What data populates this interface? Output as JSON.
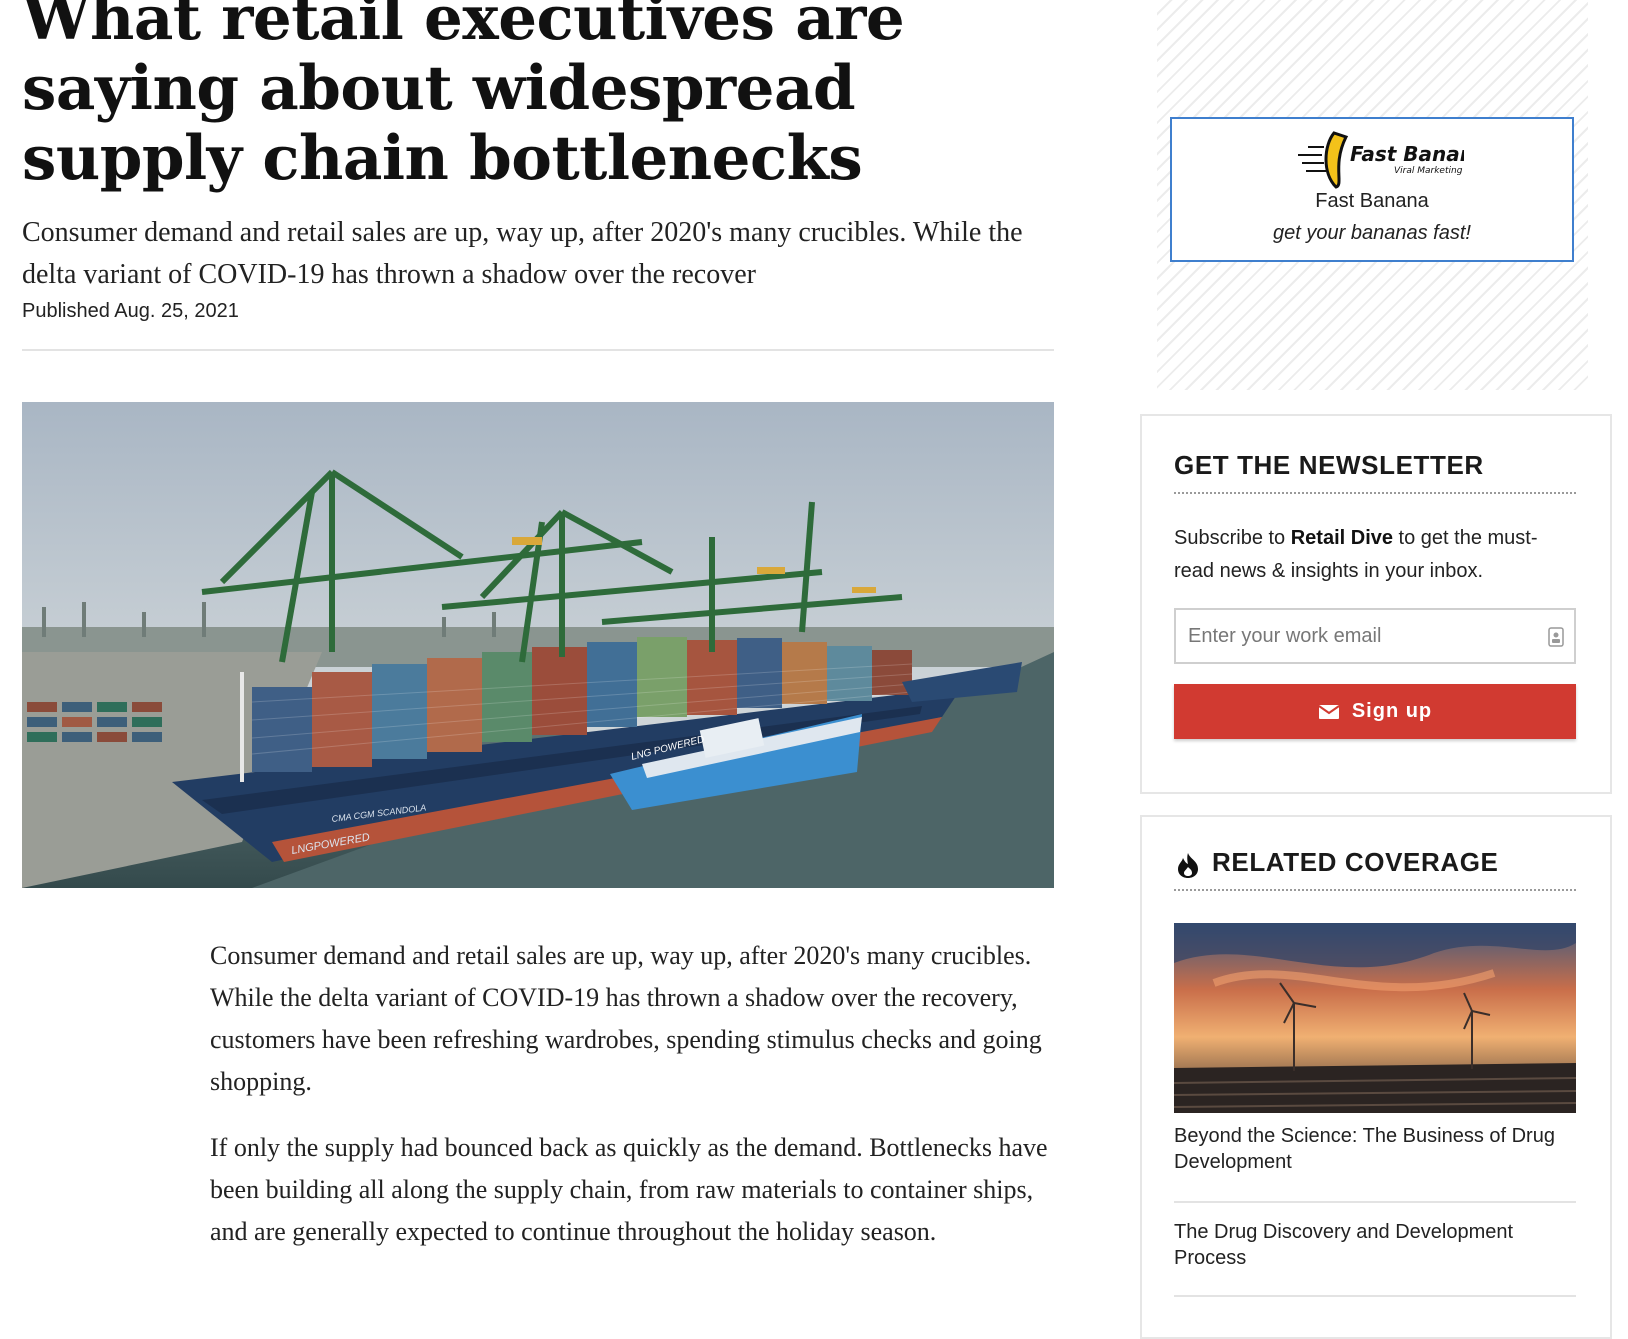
{
  "article": {
    "headline": "What retail executives are saying about widespread supply chain bottlenecks",
    "dek": "Consumer demand and retail sales are up, way up, after 2020's many crucibles. While the delta variant of COVID-19 has thrown a shadow over the recover",
    "published": "Published Aug. 25, 2021",
    "paragraphs": [
      "Consumer demand and retail sales are up, way up, after 2020's many crucibles. While the delta variant of COVID-19 has thrown a shadow over the recovery, customers have been refreshing wardrobes, spending stimulus checks and going shopping.",
      "If only the supply had bounced back as quickly as the demand. Bottlenecks have been building all along the supply chain, from raw materials to container ships, and are generally expected to continue throughout the holiday season."
    ],
    "hero_ship_labels": {
      "hull_name": "CMA CGM SCANDOLA",
      "hull_text": "LNGPOWERED",
      "bunker_text": "LNG POWERED"
    }
  },
  "ad": {
    "logo_text": "Fast Banana",
    "logo_subtext": "Viral Marketing",
    "name": "Fast Banana",
    "tagline": "get your bananas fast!"
  },
  "newsletter": {
    "title": "GET THE NEWSLETTER",
    "desc_prefix": "Subscribe to ",
    "brand": "Retail Dive",
    "desc_suffix": " to get the must-read news & insights in your inbox.",
    "email_placeholder": "Enter your work email",
    "signup_label": "Sign up",
    "accent": "#d13a31"
  },
  "related": {
    "title": "RELATED COVERAGE",
    "items": [
      "Beyond the Science: The Business of Drug Development",
      "The Drug Discovery and Development Process"
    ]
  }
}
